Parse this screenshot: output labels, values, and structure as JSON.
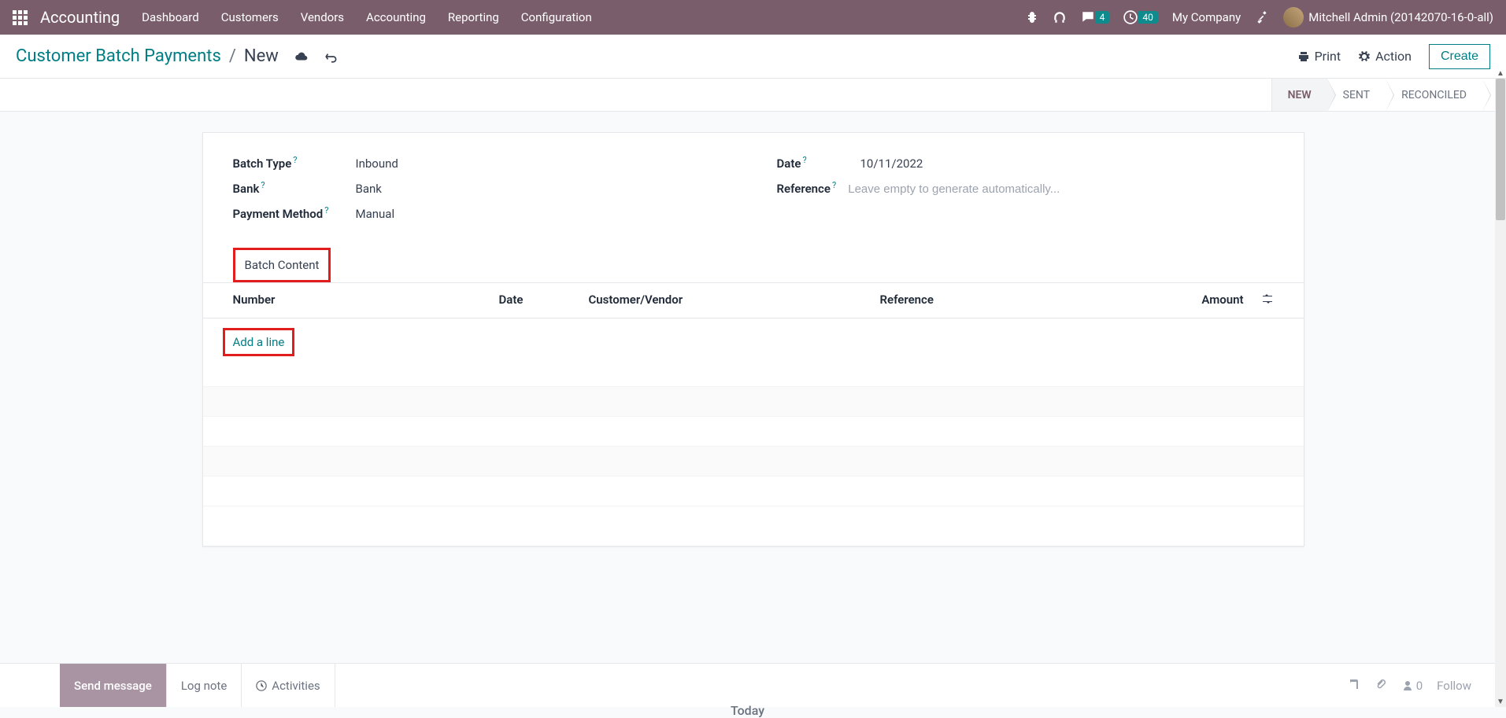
{
  "topbar": {
    "brand": "Accounting",
    "menu": [
      "Dashboard",
      "Customers",
      "Vendors",
      "Accounting",
      "Reporting",
      "Configuration"
    ],
    "msg_count": "4",
    "clock_count": "40",
    "company": "My Company",
    "user": "Mitchell Admin (20142070-16-0-all)"
  },
  "breadcrumb": {
    "parent": "Customer Batch Payments",
    "current": "New"
  },
  "control": {
    "print": "Print",
    "action": "Action",
    "create": "Create"
  },
  "status": {
    "new": "NEW",
    "sent": "SENT",
    "reconciled": "RECONCILED"
  },
  "fields": {
    "batch_type_label": "Batch Type",
    "batch_type_value": "Inbound",
    "bank_label": "Bank",
    "bank_value": "Bank",
    "payment_method_label": "Payment Method",
    "payment_method_value": "Manual",
    "date_label": "Date",
    "date_value": "10/11/2022",
    "reference_label": "Reference",
    "reference_placeholder": "Leave empty to generate automatically..."
  },
  "tab": "Batch Content",
  "columns": {
    "number": "Number",
    "date": "Date",
    "customer": "Customer/Vendor",
    "reference": "Reference",
    "amount": "Amount"
  },
  "add_line": "Add a line",
  "chatter": {
    "send": "Send message",
    "log": "Log note",
    "activities": "Activities",
    "followers": "0",
    "follow": "Follow"
  },
  "today": "Today"
}
